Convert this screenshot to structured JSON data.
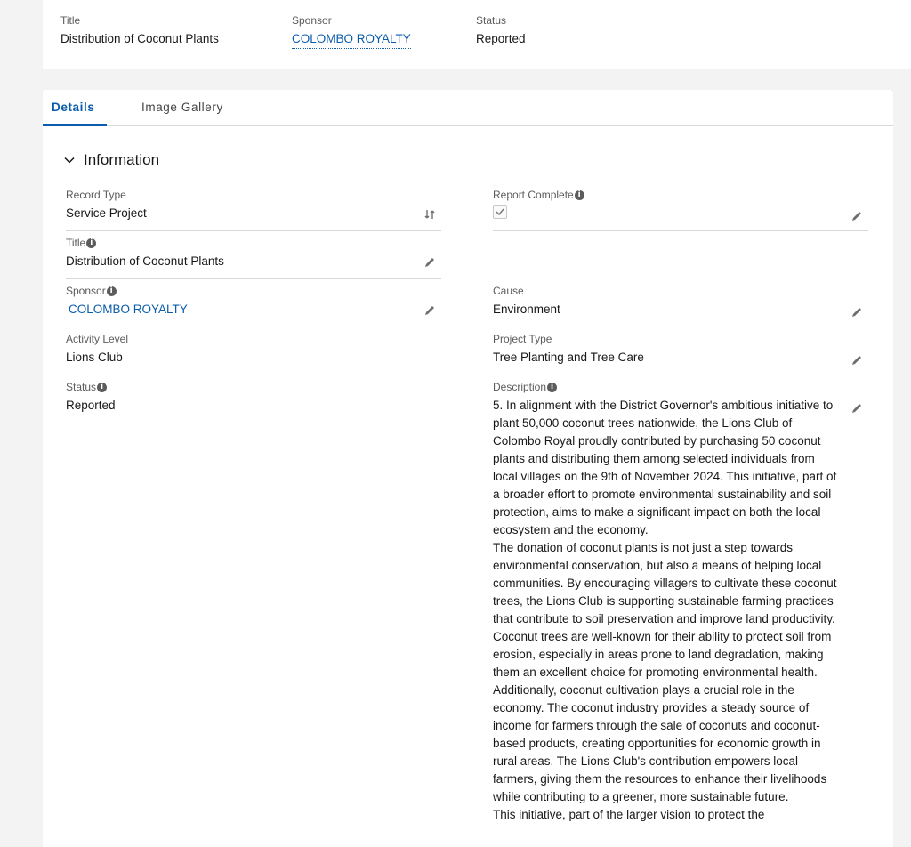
{
  "header": {
    "title_label": "Title",
    "title_value": "Distribution of Coconut Plants",
    "sponsor_label": "Sponsor",
    "sponsor_value": "COLOMBO ROYALTY",
    "status_label": "Status",
    "status_value": "Reported"
  },
  "tabs": [
    {
      "label": "Details",
      "active": true
    },
    {
      "label": "Image Gallery",
      "active": false
    }
  ],
  "section": {
    "title": "Information",
    "expanded": true
  },
  "fields": {
    "record_type": {
      "label": "Record Type",
      "value": "Service Project"
    },
    "report_complete": {
      "label": "Report Complete",
      "checked": true
    },
    "title": {
      "label": "Title",
      "value": "Distribution of Coconut Plants"
    },
    "sponsor": {
      "label": "Sponsor",
      "value": "COLOMBO ROYALTY"
    },
    "cause": {
      "label": "Cause",
      "value": "Environment"
    },
    "activity_level": {
      "label": "Activity Level",
      "value": "Lions Club"
    },
    "project_type": {
      "label": "Project Type",
      "value": "Tree Planting and Tree Care"
    },
    "status": {
      "label": "Status",
      "value": "Reported"
    },
    "description": {
      "label": "Description",
      "value": "5. In alignment with the District Governor's ambitious initiative to plant 50,000 coconut trees nationwide, the Lions Club of Colombo Royal proudly contributed by purchasing 50 coconut plants and distributing them among selected individuals from local villages on the 9th of November 2024. This initiative, part of a broader effort to promote environmental sustainability and soil protection, aims to make a significant impact on both the local ecosystem and the economy.\nThe donation of coconut plants is not just a step towards environmental conservation, but also a means of helping local communities. By encouraging villagers to cultivate these coconut trees, the Lions Club is supporting sustainable farming practices that contribute to soil preservation and improve land productivity. Coconut trees are well-known for their ability to protect soil from erosion, especially in areas prone to land degradation, making them an excellent choice for promoting environmental health.\nAdditionally, coconut cultivation plays a crucial role in the economy. The coconut industry provides a steady source of income for farmers through the sale of coconuts and coconut-based products, creating opportunities for economic growth in rural areas. The Lions Club's contribution empowers local farmers, giving them the resources to enhance their livelihoods while contributing to a greener, more sustainable future.\nThis initiative, part of the larger vision to protect the"
    }
  },
  "colors": {
    "accent": "#0b5cab",
    "text": "#181818",
    "muted": "#5c5c5c",
    "border": "#d8d8d8"
  }
}
